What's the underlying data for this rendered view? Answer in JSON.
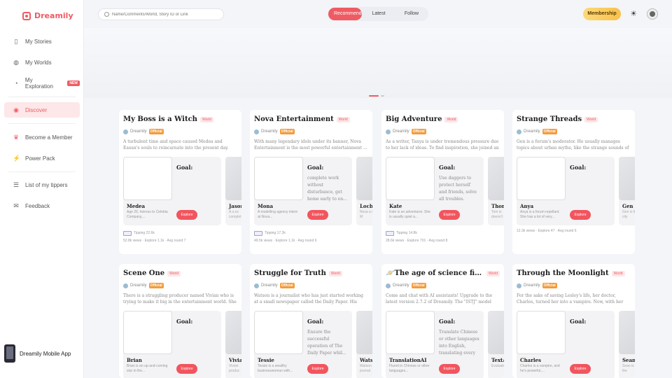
{
  "app": {
    "name": "Dreamily"
  },
  "sidebar": {
    "items": [
      {
        "label": "My Stories",
        "icon": "book-icon"
      },
      {
        "label": "My Worlds",
        "icon": "globe-icon"
      },
      {
        "label": "My Exploration",
        "icon": "compass-icon",
        "badge": "NEW"
      },
      {
        "label": "Discover",
        "icon": "discover-icon",
        "active": true
      },
      {
        "label": "Become a Member",
        "icon": "crown-icon"
      },
      {
        "label": "Power Pack",
        "icon": "power-icon"
      },
      {
        "label": "List of my tippers",
        "icon": "list-icon"
      },
      {
        "label": "Feedback",
        "icon": "chat-icon"
      }
    ],
    "mobile_app": "Dreamily Mobile App"
  },
  "header": {
    "search_placeholder": "Name/Comments/World, Story ID or Link",
    "tabs": [
      "Recommend",
      "Latest",
      "Follow"
    ],
    "active_tab": "Recommend",
    "membership": "Membership"
  },
  "colors": {
    "accent": "#ef5b63",
    "membership": "#f8c14a"
  },
  "cards": [
    {
      "title": "My Boss is a Witch",
      "tag": "World",
      "author": "Dreamily",
      "official": "Official",
      "desc": "A turbulent time and space caused Medea and Easun's souls to reincarnate into the present day. Medea became...",
      "char_name": "Medea",
      "char_sub": "Age 26, heiress to Celebia Company,...",
      "goal": "Goal:",
      "goal_text": "",
      "explore": "Explore",
      "next_name": "Jason",
      "next_sub": "A.s.ex complet",
      "tips": "Tipping 22.6k",
      "stats": "52.8k views · Explore 1.1k · Avg round 7"
    },
    {
      "title": "Nova Entertainment",
      "tag": "World",
      "author": "Dreamily",
      "official": "Official",
      "desc": "With many legendary idols under its banner, Nova Entertainment is the most powerful entertainment ...",
      "char_name": "Mona",
      "char_sub": "A modelling agency intern at Nova...",
      "goal": "Goal:",
      "goal_text": "complete work without disturbance, get home early to en...",
      "explore": "Explore",
      "next_name": "Loch",
      "next_sub": "Nova a idol, M",
      "tips": "Tipping 17.3k",
      "stats": "49.5k views · Explore 1.1k · Avg round 6"
    },
    {
      "title": "Big Adventure",
      "tag": "World",
      "author": "Dreamily",
      "official": "Official",
      "desc": "As a writer, Tanya is under tremendous pressure due to her lack of ideas. To find inspiration, she joined an ...",
      "char_name": "Kate",
      "char_sub": "Kate is an adventurer. She is usually quiet a...",
      "goal": "Goal:",
      "goal_text": "Use daggers to protect herself and friends, solve all troubles.",
      "explore": "Explore",
      "next_name": "Thom",
      "next_sub": "Tom is doesn't",
      "tips": "Tipping 14.8k",
      "stats": "28.6k views · Explore 701 · Avg round 8"
    },
    {
      "title": "Strange Threads",
      "tag": "World",
      "author": "Dreamily",
      "official": "Official",
      "desc": "Gen is a forum's moderator. He usually manages topics about urban myths, like the strange sounds of subway ...",
      "char_name": "Anya",
      "char_sub": "Anya is a forum repellant. She has a lot of very...",
      "goal": "Goal:",
      "goal_text": "",
      "explore": "Explore",
      "next_name": "Gen",
      "next_sub": "Gen is the city",
      "tips": "",
      "stats": "12.3k views · Explore 47 · Avg round 6"
    },
    {
      "title": "Scene One",
      "tag": "World",
      "author": "Dreamily",
      "official": "Official",
      "desc": "There is a struggling producer named Vivian who is trying to make it big in the entertainment world. She ...",
      "char_name": "Brian",
      "char_sub": "Brian is an up-and-coming star in the...",
      "goal": "Goal:",
      "goal_text": "",
      "explore": "Explore",
      "next_name": "Vivian",
      "next_sub": "Vivian produc",
      "tips": "",
      "stats": ""
    },
    {
      "title": "Struggle for Truth",
      "tag": "World",
      "author": "Dreamily",
      "official": "Official",
      "desc": "Watson is a journalist who has just started working at a small newspaper called the Daily Paper. His boss, a fe...",
      "char_name": "Tessie",
      "char_sub": "Tessie is a wealthy businesswoman with...",
      "goal": "Goal:",
      "goal_text": "Ensure the successful operation of The Daily Paper whil...",
      "explore": "Explore",
      "next_name": "Watso",
      "next_sub": "Watson journal",
      "tips": "",
      "stats": ""
    },
    {
      "title": "🪐The age of science fiction is comi...",
      "tag": "World",
      "author": "Dreamily",
      "official": "Official",
      "desc": "Come and chat with AI assistants! Upgrade to the latest version 2.7.2 of Dreamily. The \"ISTJ\" model works eve...",
      "char_name": "TranslationAI",
      "char_sub": "Fluent in Chinese or other languages...",
      "goal": "Goal:",
      "goal_text": "Translate Chinese or other languages into English, translating every ...",
      "explore": "Explore",
      "next_name": "TextA",
      "next_sub": "Evaluate",
      "tips": "",
      "stats": ""
    },
    {
      "title": "Through the Moonlight",
      "tag": "World",
      "author": "Dreamily",
      "official": "Official",
      "desc": "For the sake of saving Lesley's life, her doctor, Charles, turned her into a vampire. Now, with her new strength ...",
      "char_name": "Charles",
      "char_sub": "Charles is a vampire, and he's powerful,...",
      "goal": "Goal:",
      "goal_text": "",
      "explore": "Explore",
      "next_name": "Sean",
      "next_sub": "Sean is of the",
      "tips": "",
      "stats": ""
    }
  ]
}
